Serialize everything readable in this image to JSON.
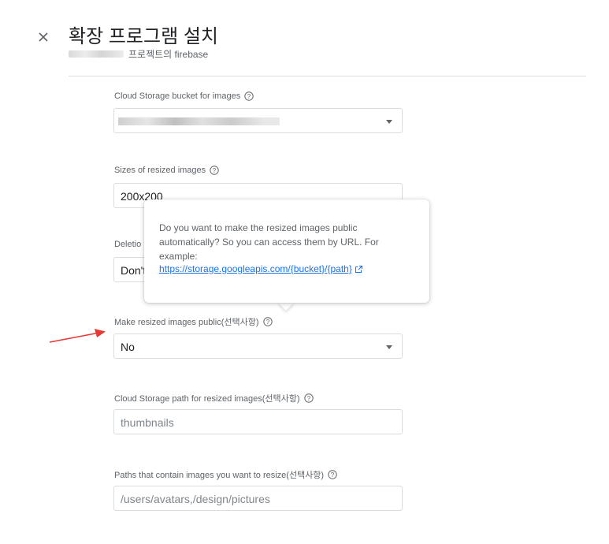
{
  "header": {
    "close_icon": "close-icon",
    "title": "확장 프로그램 설치",
    "subtitle_suffix": "프로젝트의 firebase"
  },
  "form": {
    "bucket": {
      "label": "Cloud Storage bucket for images",
      "value_redacted": true
    },
    "sizes": {
      "label": "Sizes of resized images",
      "value": "200x200"
    },
    "deletion": {
      "label_partial": "Deletio",
      "value_partial": "Don't"
    },
    "public": {
      "label": "Make resized images public(선택사항)",
      "value": "No"
    },
    "path": {
      "label": "Cloud Storage path for resized images(선택사항)",
      "placeholder": "thumbnails"
    },
    "include_paths": {
      "label": "Paths that contain images you want to resize(선택사항)",
      "placeholder": "/users/avatars,/design/pictures"
    }
  },
  "tooltip": {
    "text": "Do you want to make the resized images public automatically? So you can access them by URL. For example:",
    "link": "https://storage.googleapis.com/{bucket}/{path}"
  },
  "colors": {
    "accent_link": "#1a73e8",
    "annotation_arrow": "#e53935"
  }
}
